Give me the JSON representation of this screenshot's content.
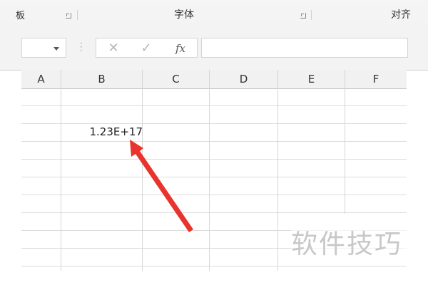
{
  "ribbon": {
    "groups": [
      {
        "label": "板"
      },
      {
        "label": "字体"
      },
      {
        "label": "对齐"
      }
    ]
  },
  "formula_bar": {
    "name_box_value": "",
    "cancel_icon": "close-icon",
    "enter_icon": "check-icon",
    "function_label": "fx",
    "formula_value": ""
  },
  "sheet": {
    "columns": [
      "A",
      "B",
      "C",
      "D",
      "E",
      "F"
    ],
    "cells": {
      "B2": "1.23E+17"
    }
  },
  "annotation": {
    "arrow_color": "#e8342c"
  },
  "watermark": "软件技巧"
}
